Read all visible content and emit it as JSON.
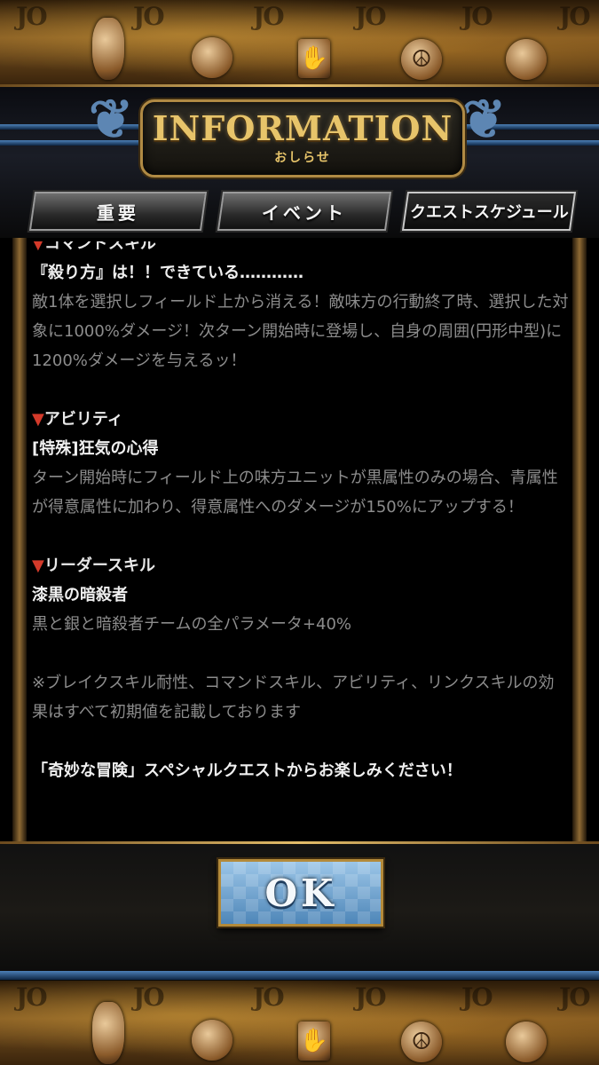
{
  "header": {
    "title": "INFORMATION",
    "subtitle": "おしらせ"
  },
  "tabs": [
    {
      "label": "重要",
      "active": false
    },
    {
      "label": "イベント",
      "active": false
    },
    {
      "label": "クエストスケジュール",
      "active": true
    }
  ],
  "content": {
    "command_skill": {
      "heading": "コマンドスキル",
      "name": "『殺り方』は！！できている…………",
      "description": "敵1体を選択しフィールド上から消える！敵味方の行動終了時、選択した対象に1000%ダメージ！次ターン開始時に登場し、自身の周囲(円形中型)に1200%ダメージを与えるッ！"
    },
    "ability": {
      "heading": "アビリティ",
      "name": "[特殊]狂気の心得",
      "description": "ターン開始時にフィールド上の味方ユニットが黒属性のみの場合、青属性が得意属性に加わり、得意属性へのダメージが150%にアップする！"
    },
    "leader_skill": {
      "heading": "リーダースキル",
      "name": "漆黒の暗殺者",
      "description": "黒と銀と暗殺者チームの全パラメータ+40%"
    },
    "note": "※ブレイクスキル耐性、コマンドスキル、アビリティ、リンクスキルの効果はすべて初期値を記載しております",
    "closing": "「奇妙な冒険」スペシャルクエストからお楽しみください！"
  },
  "ok_button": {
    "label": "OK"
  },
  "banner": {
    "jo_text": "JO",
    "peace_symbol": "☮",
    "hand_symbol": "✋"
  },
  "colors": {
    "accent_gold": "#e7c46a",
    "triangle_red": "#d43a2a",
    "rail_blue": "#4c7fb6"
  }
}
